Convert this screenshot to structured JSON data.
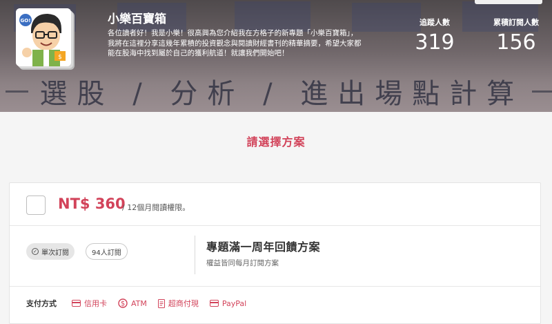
{
  "blog": {
    "name": "小樂百寶箱",
    "description": "各位讀者好！我是小樂！很高興為您介紹我在方格子的新專題「小樂百寶箱」，我將在這裡分享這幾年累積的投資觀念與閱讀財經書刊的精華摘要，希望大家都能在股海中找到屬於自己的獲利航道！就讓我們開始吧！",
    "cover_title": "選股 / 分析 / 進出場點計算",
    "avatar_badge": "GO!"
  },
  "stats": {
    "followers_label": "追蹤人數",
    "followers_value": "319",
    "subscribers_label": "累積訂閱人數",
    "subscribers_value": "156"
  },
  "section": {
    "title": "請選擇方案"
  },
  "plan": {
    "price": "NT$ 360",
    "period": "/ 12個月閱讀權限。",
    "type_badge": "單次訂閱",
    "count_badge": "94人訂閱",
    "name": "專題滿一周年回饋方案",
    "note": "權益皆同每月訂閱方案"
  },
  "payment": {
    "label": "支付方式",
    "options": [
      "信用卡",
      "ATM",
      "超商付現",
      "PayPal"
    ],
    "accent_color": "#d2435a"
  },
  "icons": [
    "avatar-cartoon",
    "check-circle-icon",
    "credit-card-icon",
    "dollar-icon",
    "receipt-icon",
    "paypal-card-icon"
  ]
}
